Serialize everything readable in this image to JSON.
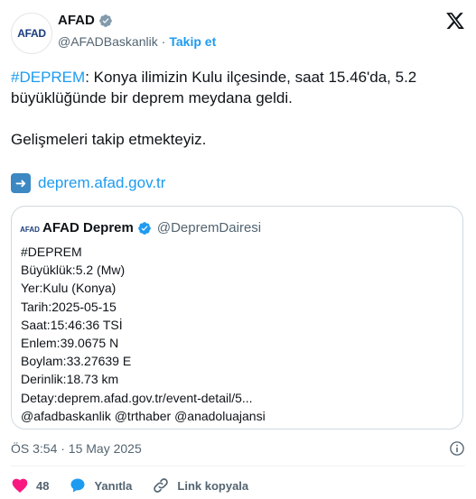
{
  "account": {
    "name": "AFAD",
    "handle": "@AFADBaskanlik",
    "separator": "·",
    "follow_label": "Takip et",
    "avatar_text": "AFAD"
  },
  "tweet": {
    "hashtag": "#DEPREM",
    "text_rest": ": Konya ilimizin Kulu ilçesinde, saat 15.46'da, 5.2 büyüklüğünde bir deprem meydana geldi.",
    "paragraph2": "Gelişmeleri takip etmekteyiz.",
    "link_text": "deprem.afad.gov.tr"
  },
  "quote": {
    "name": "AFAD Deprem",
    "handle": "@DepremDairesi",
    "avatar_text": "AFAD",
    "lines": [
      "#DEPREM",
      "Büyüklük:5.2 (Mw)",
      "Yer:Kulu (Konya)",
      "Tarih:2025-05-15",
      "Saat:15:46:36 TSİ",
      "Enlem:39.0675 N",
      "Boylam:33.27639 E",
      "Derinlik:18.73 km",
      "Detay:deprem.afad.gov.tr/event-detail/5...",
      "@afadbaskanlik @trthaber @anadoluajansi"
    ]
  },
  "footer": {
    "timestamp": "ÖS 3:54 · 15 May 2025",
    "likes": "48",
    "reply_label": "Yanıtla",
    "copy_link_label": "Link kopyala"
  },
  "colors": {
    "accent": "#1d9bf0",
    "like": "#f91880",
    "muted": "#536471"
  }
}
